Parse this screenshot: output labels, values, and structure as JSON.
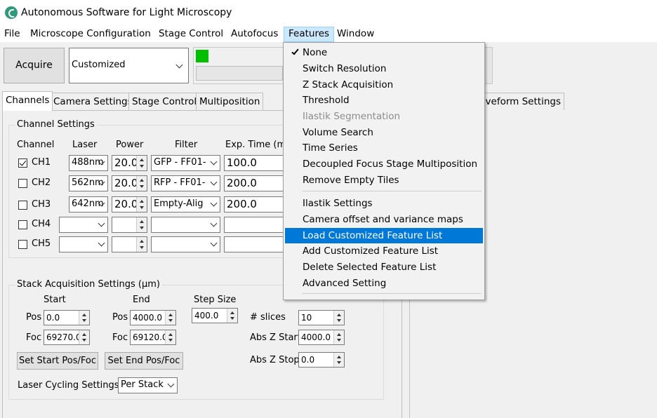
{
  "window": {
    "title": "Autonomous Software for Light Microscopy"
  },
  "menubar": [
    "File",
    "Microscope Configuration",
    "Stage Control",
    "Autofocus",
    "Features",
    "Window"
  ],
  "toolbar": {
    "acquire_label": "Acquire",
    "mode_value": "Customized"
  },
  "tabs": [
    "Channels",
    "Camera Settings",
    "Stage Control",
    "Multiposition",
    "Waveform Settings"
  ],
  "channel_settings": {
    "title": "Channel Settings",
    "headers": [
      "Channel",
      "Laser",
      "Power",
      "Filter",
      "Exp. Time (m"
    ],
    "rows": [
      {
        "name": "CH1",
        "checked": true,
        "laser": "488nm",
        "power": "20.0",
        "filter": "GFP - FF01-",
        "exp": "100.0"
      },
      {
        "name": "CH2",
        "checked": false,
        "laser": "562nm",
        "power": "20.0",
        "filter": "RFP - FF01-",
        "exp": "200.0"
      },
      {
        "name": "CH3",
        "checked": false,
        "laser": "642nm",
        "power": "20.0",
        "filter": "Empty-Alig",
        "exp": "200.0"
      },
      {
        "name": "CH4",
        "checked": false,
        "laser": "",
        "power": "",
        "filter": "",
        "exp": ""
      },
      {
        "name": "CH5",
        "checked": false,
        "laser": "",
        "power": "",
        "filter": "",
        "exp": ""
      }
    ]
  },
  "stack": {
    "title": "Stack Acquisition Settings (μm)",
    "start_label": "Start",
    "end_label": "End",
    "step_label": "Step Size",
    "pos_label": "Pos",
    "foc_label": "Foc",
    "start_pos": "0.0",
    "start_foc": "69270.0",
    "end_pos": "4000.0",
    "end_foc": "69120.0",
    "step": "400.0",
    "slices_label": "# slices",
    "slices": "10",
    "abs_start_label": "Abs Z Start",
    "abs_start": "4000.0",
    "abs_stop_label": "Abs Z Stop",
    "abs_stop": "0.0",
    "set_start_label": "Set Start Pos/Foc",
    "set_end_label": "Set End Pos/Foc",
    "laser_cycling_label": "Laser Cycling Settings",
    "laser_cycling_value": "Per Stack"
  },
  "features_menu": {
    "group1": [
      {
        "label": "None",
        "checked": true,
        "disabled": false
      },
      {
        "label": "Switch Resolution",
        "checked": false,
        "disabled": false
      },
      {
        "label": "Z Stack Acquisition",
        "checked": false,
        "disabled": false
      },
      {
        "label": "Threshold",
        "checked": false,
        "disabled": false
      },
      {
        "label": "Ilastik Segmentation",
        "checked": false,
        "disabled": true
      },
      {
        "label": "Volume Search",
        "checked": false,
        "disabled": false
      },
      {
        "label": "Time Series",
        "checked": false,
        "disabled": false
      },
      {
        "label": "Decoupled Focus Stage Multiposition",
        "checked": false,
        "disabled": false
      },
      {
        "label": "Remove Empty Tiles",
        "checked": false,
        "disabled": false
      }
    ],
    "group2": [
      {
        "label": "Ilastik Settings"
      },
      {
        "label": "Camera offset and variance maps"
      },
      {
        "label": "Load Customized Feature List",
        "highlighted": true
      },
      {
        "label": "Add Customized Feature List"
      },
      {
        "label": "Delete Selected Feature List"
      },
      {
        "label": "Advanced Setting"
      }
    ]
  },
  "colors": {
    "status_indicator": "#00c000",
    "highlight": "#0078d7",
    "app_icon": "#2f9a7a"
  }
}
